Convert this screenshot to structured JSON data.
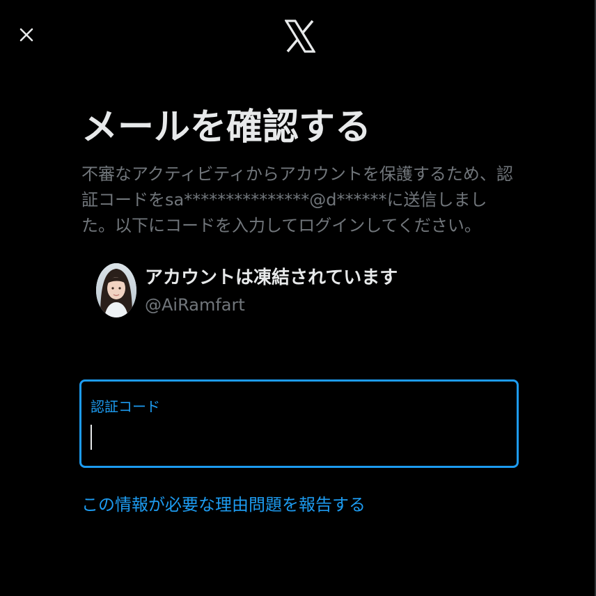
{
  "dialog": {
    "close_icon": "close-icon",
    "logo_icon": "x-logo-icon",
    "title": "メールを確認する",
    "description": "不審なアクティビティからアカウントを保護するため、認証コードをsa***************@d******に送信しました。以下にコードを入力してログインしてください。"
  },
  "account": {
    "avatar_icon": "avatar",
    "status": "アカウントは凍結されています",
    "handle": "@AiRamfart"
  },
  "verification": {
    "label": "認証コード",
    "value": ""
  },
  "links": {
    "report": "この情報が必要な理由問題を報告する"
  },
  "colors": {
    "background": "#000000",
    "text_primary": "#e7e9ea",
    "text_secondary": "#71767b",
    "accent": "#1d9bf0"
  }
}
